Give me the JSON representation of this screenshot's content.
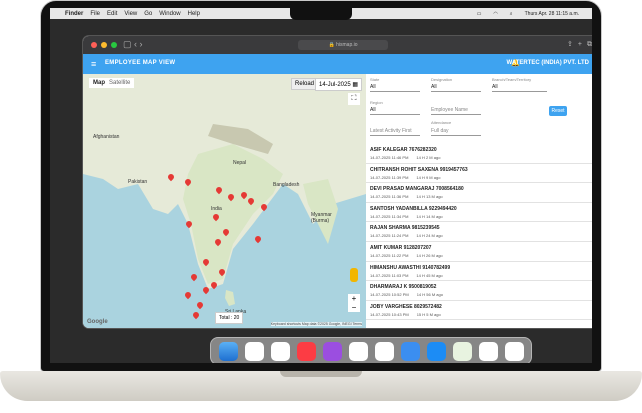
{
  "menubar": {
    "app": "Finder",
    "items": [
      "File",
      "Edit",
      "View",
      "Go",
      "Window",
      "Help"
    ],
    "datetime": "Thurs Apr. 28 11:15 a.m."
  },
  "browser": {
    "url": "hismap.io"
  },
  "header": {
    "title": "EMPLOYEE MAP VIEW",
    "company": "WATERTEC (INDIA) PVT. LTD",
    "color": "#3ea3f0"
  },
  "map": {
    "toggle_map": "Map",
    "toggle_satellite": "Satellite",
    "reload": "Reload",
    "date": "14-Jul-2025",
    "total": "Total : 20",
    "google": "Google",
    "attribution": "Keyboard shortcuts   Map data ©2025 Google, INEGI   Terms",
    "labels": [
      "Afghanistan",
      "Pakistan",
      "India",
      "Nepal",
      "Myanmar (Burma)",
      "Sri Lanka",
      "Bangladesh"
    ],
    "pin_color": "#e53935"
  },
  "filters": {
    "state_label": "State",
    "state_value": "All",
    "designation_label": "Designation",
    "designation_value": "All",
    "branch_label": "Branch/Team/Territory",
    "branch_value": "All",
    "region_label": "Region",
    "region_value": "All",
    "employee_placeholder": "Employee Name",
    "activity_value": "Latest Activity First",
    "attendance_label": "Attendance",
    "attendance_value": "Full day",
    "reset": "Reset"
  },
  "employees": [
    {
      "name": "ASIF KALEGAR 7676282320",
      "date": "14-07-2025 11:46 PM",
      "ago": "14 H 2 M ago"
    },
    {
      "name": "CHITRANSH ROHIT SAXENA 9919457763",
      "date": "14-07-2025 11:39 PM",
      "ago": "14 H 9 M ago"
    },
    {
      "name": "DEVI PRASAD MANGARAJ 7008564180",
      "date": "14-07-2025 11:36 PM",
      "ago": "14 H 13 M ago"
    },
    {
      "name": "SANTOSH YADANBILLA 9229494420",
      "date": "14-07-2025 11:34 PM",
      "ago": "14 H 14 M ago"
    },
    {
      "name": "RAJAN SHARMA 9815239545",
      "date": "14-07-2025 11:24 PM",
      "ago": "14 H 24 M ago"
    },
    {
      "name": "AMIT KUMAR 9128207207",
      "date": "14-07-2025 11:22 PM",
      "ago": "14 H 26 M ago"
    },
    {
      "name": "HIMANSHU AWASTHI 9140782499",
      "date": "14-07-2025 11:03 PM",
      "ago": "14 H 45 M ago"
    },
    {
      "name": "DHARMARAJ K 9500819052",
      "date": "14-07-2025 10:52 PM",
      "ago": "14 H 56 M ago"
    },
    {
      "name": "JOBY VARGHESE 8029572482",
      "date": "14-07-2025 10:43 PM",
      "ago": "15 H 5 M ago"
    }
  ]
}
